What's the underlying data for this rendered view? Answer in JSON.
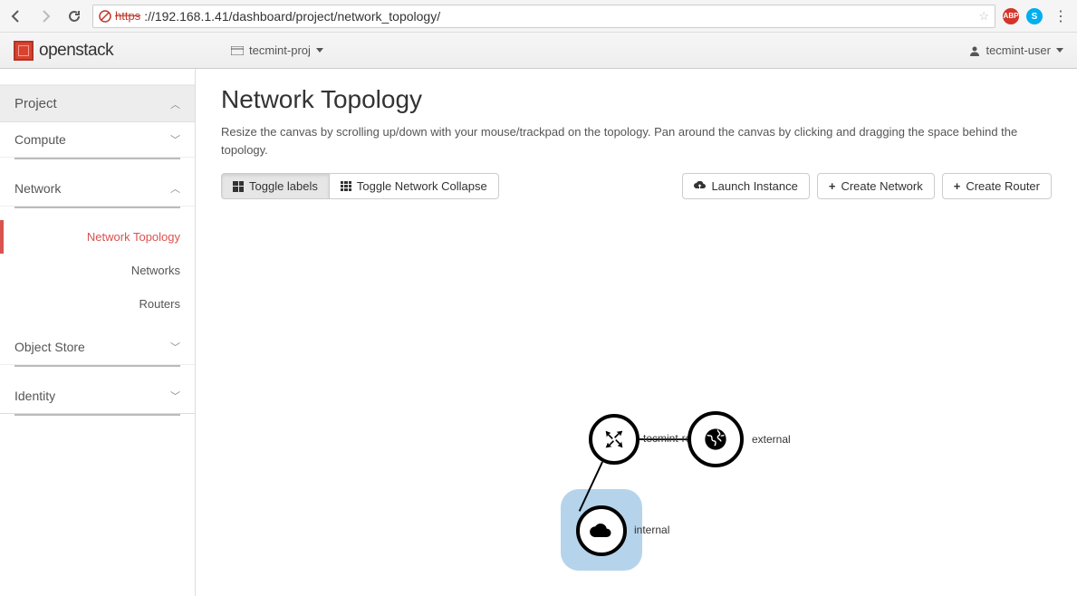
{
  "browser": {
    "url_scheme_crossed": "https",
    "url_rest": "://192.168.1.41/dashboard/project/network_topology/"
  },
  "header": {
    "brand": "openstack",
    "project_label": "tecmint-proj",
    "user_label": "tecmint-user"
  },
  "sidebar": {
    "navs": [
      {
        "label": "Project",
        "open": true,
        "chev": "up"
      },
      {
        "label": "Compute",
        "open": false,
        "chev": "down"
      },
      {
        "label": "Network",
        "open": true,
        "chev": "up",
        "items": [
          {
            "label": "Network Topology",
            "active": true
          },
          {
            "label": "Networks"
          },
          {
            "label": "Routers"
          }
        ]
      },
      {
        "label": "Object Store",
        "chev": "down"
      },
      {
        "label": "Identity",
        "chev": "down"
      }
    ]
  },
  "main": {
    "title": "Network Topology",
    "description": "Resize the canvas by scrolling up/down with your mouse/trackpad on the topology. Pan around the canvas by clicking and dragging the space behind the topology.",
    "btn_toggle_labels": "Toggle labels",
    "btn_toggle_collapse": "Toggle Network Collapse",
    "btn_launch": "Launch Instance",
    "btn_create_network": "Create Network",
    "btn_create_router": "Create Router"
  },
  "topology": {
    "router_label": "tecmint-router",
    "external_label": "external",
    "internal_label": "internal"
  }
}
